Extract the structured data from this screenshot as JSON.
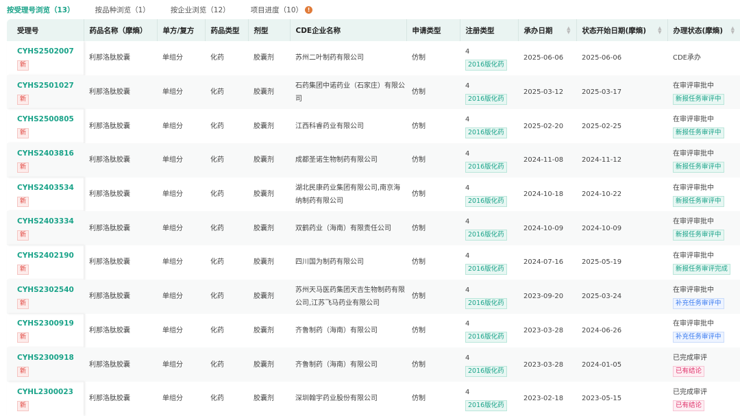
{
  "tabs": [
    {
      "label": "按受理号浏览（13）",
      "active": true
    },
    {
      "label": "按品种浏览（1）"
    },
    {
      "label": "按企业浏览（12）"
    },
    {
      "label": "项目进度（10）",
      "badge": "!"
    }
  ],
  "columns": [
    "受理号",
    "药品名称（摩熵）",
    "单方/复方",
    "药品类型",
    "剂型",
    "CDE企业名称",
    "申请类型",
    "注册类型",
    "承办日期",
    "状态开始日期(摩熵)",
    "办理状态(摩熵)"
  ],
  "new_label": "新",
  "rows": [
    {
      "id": "CYHS2502007",
      "name": "利那洛肽胶囊",
      "compound": "单组分",
      "type": "化药",
      "form": "胶囊剂",
      "company": "苏州二叶制药有限公司",
      "apply": "仿制",
      "reg_num": "4",
      "reg_tag": "2016版化药",
      "date": "2025-06-06",
      "status_date": "2025-06-06",
      "status": "CDE承办",
      "status_tag": "",
      "tag_color": ""
    },
    {
      "id": "CYHS2501027",
      "name": "利那洛肽胶囊",
      "compound": "单组分",
      "type": "化药",
      "form": "胶囊剂",
      "company": "石药集团中诺药业（石家庄）有限公司",
      "apply": "仿制",
      "reg_num": "4",
      "reg_tag": "2016版化药",
      "date": "2025-03-12",
      "status_date": "2025-03-17",
      "status": "在审评审批中",
      "status_tag": "新报任务审评中",
      "tag_color": "green"
    },
    {
      "id": "CYHS2500805",
      "name": "利那洛肽胶囊",
      "compound": "单组分",
      "type": "化药",
      "form": "胶囊剂",
      "company": "江西科睿药业有限公司",
      "apply": "仿制",
      "reg_num": "4",
      "reg_tag": "2016版化药",
      "date": "2025-02-20",
      "status_date": "2025-02-25",
      "status": "在审评审批中",
      "status_tag": "新报任务审评中",
      "tag_color": "green"
    },
    {
      "id": "CYHS2403816",
      "name": "利那洛肽胶囊",
      "compound": "单组分",
      "type": "化药",
      "form": "胶囊剂",
      "company": "成都圣诺生物制药有限公司",
      "apply": "仿制",
      "reg_num": "4",
      "reg_tag": "2016版化药",
      "date": "2024-11-08",
      "status_date": "2024-11-12",
      "status": "在审评审批中",
      "status_tag": "新报任务审评中",
      "tag_color": "green"
    },
    {
      "id": "CYHS2403534",
      "name": "利那洛肽胶囊",
      "compound": "单组分",
      "type": "化药",
      "form": "胶囊剂",
      "company": "湖北民康药业集团有限公司,南京海纳制药有限公司",
      "apply": "仿制",
      "reg_num": "4",
      "reg_tag": "2016版化药",
      "date": "2024-10-18",
      "status_date": "2024-10-22",
      "status": "在审评审批中",
      "status_tag": "新报任务审评中",
      "tag_color": "green"
    },
    {
      "id": "CYHS2403334",
      "name": "利那洛肽胶囊",
      "compound": "单组分",
      "type": "化药",
      "form": "胶囊剂",
      "company": "双鹤药业（海南）有限责任公司",
      "apply": "仿制",
      "reg_num": "4",
      "reg_tag": "2016版化药",
      "date": "2024-10-09",
      "status_date": "2024-10-09",
      "status": "在审评审批中",
      "status_tag": "新报任务审评中",
      "tag_color": "green"
    },
    {
      "id": "CYHS2402190",
      "name": "利那洛肽胶囊",
      "compound": "单组分",
      "type": "化药",
      "form": "胶囊剂",
      "company": "四川国为制药有限公司",
      "apply": "仿制",
      "reg_num": "4",
      "reg_tag": "2016版化药",
      "date": "2024-07-16",
      "status_date": "2025-05-19",
      "status": "在审评审批中",
      "status_tag": "新报任务审评完成",
      "tag_color": "green"
    },
    {
      "id": "CYHS2302540",
      "name": "利那洛肽胶囊",
      "compound": "单组分",
      "type": "化药",
      "form": "胶囊剂",
      "company": "苏州天马医药集团天吉生物制药有限公司,江苏飞马药业有限公司",
      "apply": "仿制",
      "reg_num": "4",
      "reg_tag": "2016版化药",
      "date": "2023-09-20",
      "status_date": "2025-03-24",
      "status": "在审评审批中",
      "status_tag": "补充任务审评中",
      "tag_color": "blue"
    },
    {
      "id": "CYHS2300919",
      "name": "利那洛肽胶囊",
      "compound": "单组分",
      "type": "化药",
      "form": "胶囊剂",
      "company": "齐鲁制药（海南）有限公司",
      "apply": "仿制",
      "reg_num": "4",
      "reg_tag": "2016版化药",
      "date": "2023-03-28",
      "status_date": "2024-06-26",
      "status": "在审评审批中",
      "status_tag": "补充任务审评中",
      "tag_color": "blue"
    },
    {
      "id": "CYHS2300918",
      "name": "利那洛肽胶囊",
      "compound": "单组分",
      "type": "化药",
      "form": "胶囊剂",
      "company": "齐鲁制药（海南）有限公司",
      "apply": "仿制",
      "reg_num": "4",
      "reg_tag": "2016版化药",
      "date": "2023-03-28",
      "status_date": "2024-01-05",
      "status": "已完成审评",
      "status_tag": "已有结论",
      "tag_color": "red"
    },
    {
      "id": "CYHL2300023",
      "name": "利那洛肽胶囊",
      "compound": "单组分",
      "type": "化药",
      "form": "胶囊剂",
      "company": "深圳翰宇药业股份有限公司",
      "apply": "仿制",
      "reg_num": "4",
      "reg_tag": "2016版化药",
      "date": "2023-02-18",
      "status_date": "2023-05-15",
      "status": "已完成审评",
      "status_tag": "已有结论",
      "tag_color": "red"
    }
  ]
}
